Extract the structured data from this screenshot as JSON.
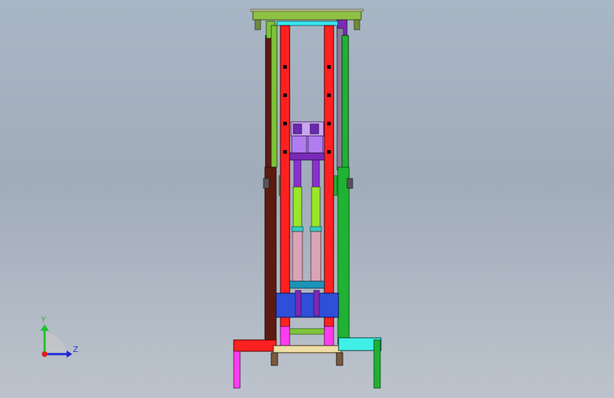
{
  "viewport": {
    "background_top": "#a9b6c5",
    "background_bottom": "#bcc3cc"
  },
  "triad": {
    "y_label": "Y",
    "z_label": "Z",
    "y_color": "#21c128",
    "z_color": "#1f27d6",
    "origin_color": "#e02020"
  },
  "model": {
    "colors": {
      "top_plate": "#8ec043",
      "red_column": "#ff2020",
      "dark_column": "#5c1a10",
      "green_column": "#1fb233",
      "cyan_bar": "#35e6f0",
      "purple_block": "#a86ce0",
      "lime_rod": "#9ae62a",
      "pink_rod": "#d9a3b8",
      "blue_plate": "#2f4fd8",
      "teal_plate": "#1b94b8",
      "magenta_foot": "#ff3cf0",
      "beige_base": "#f0dfa6",
      "cyan_leg": "#3ff0e6"
    }
  }
}
